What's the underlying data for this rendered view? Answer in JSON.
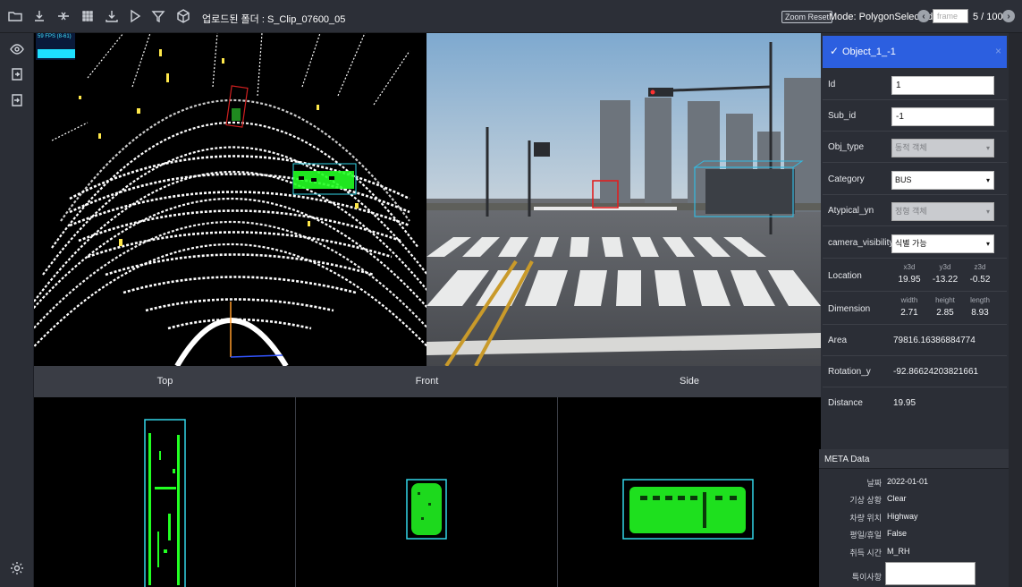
{
  "topbar": {
    "folder_label": "업로드된 폴더 : S_Clip_07600_05",
    "zoom_reset": "Zoom Reset",
    "mode": "Mode: PolygonSelected",
    "frame_placeholder": "frame",
    "frame_count": "5 / 100",
    "icons": [
      "folder-icon",
      "download-icon",
      "compress-icon",
      "grid-icon",
      "export-icon",
      "play-icon",
      "filter-icon",
      "cube-icon"
    ]
  },
  "sidebar": {
    "icons": [
      "eye-icon",
      "import-icon",
      "export-file-icon",
      "settings-icon"
    ]
  },
  "lidar": {
    "fps_text": "59 FPS (8-61)"
  },
  "views": {
    "tabs": [
      "Top",
      "Front",
      "Side"
    ]
  },
  "object": {
    "title": "Object_1_-1",
    "fields": {
      "id_label": "Id",
      "id_value": "1",
      "sub_id_label": "Sub_id",
      "sub_id_value": "-1",
      "obj_type_label": "Obj_type",
      "obj_type_value": "동적 객체",
      "category_label": "Category",
      "category_value": "BUS",
      "atypical_label": "Atypical_yn",
      "atypical_value": "정형 객체",
      "camera_visibility_label": "camera_visibility",
      "camera_visibility_value": "식별 가능"
    },
    "location": {
      "label": "Location",
      "x_h": "x3d",
      "y_h": "y3d",
      "z_h": "z3d",
      "x": "19.95",
      "y": "-13.22",
      "z": "-0.52"
    },
    "dimension": {
      "label": "Dimension",
      "w_h": "width",
      "h_h": "height",
      "l_h": "length",
      "w": "2.71",
      "h": "2.85",
      "l": "8.93"
    },
    "area": {
      "label": "Area",
      "value": "79816.16386884774"
    },
    "rotation": {
      "label": "Rotation_y",
      "value": "-92.86624203821661"
    },
    "distance": {
      "label": "Distance",
      "value": "19.95"
    }
  },
  "meta": {
    "title": "META Data",
    "rows": [
      {
        "k": "날짜",
        "v": "2022-01-01"
      },
      {
        "k": "기상 상황",
        "v": "Clear"
      },
      {
        "k": "차량 위치",
        "v": "Highway"
      },
      {
        "k": "평일/휴일",
        "v": "False"
      },
      {
        "k": "취득 시간",
        "v": "M_RH"
      },
      {
        "k": "특이사항",
        "v": ""
      }
    ]
  },
  "colors": {
    "accent": "#2c5fe0",
    "points": "#22ff22",
    "box": "#33d6e8"
  }
}
